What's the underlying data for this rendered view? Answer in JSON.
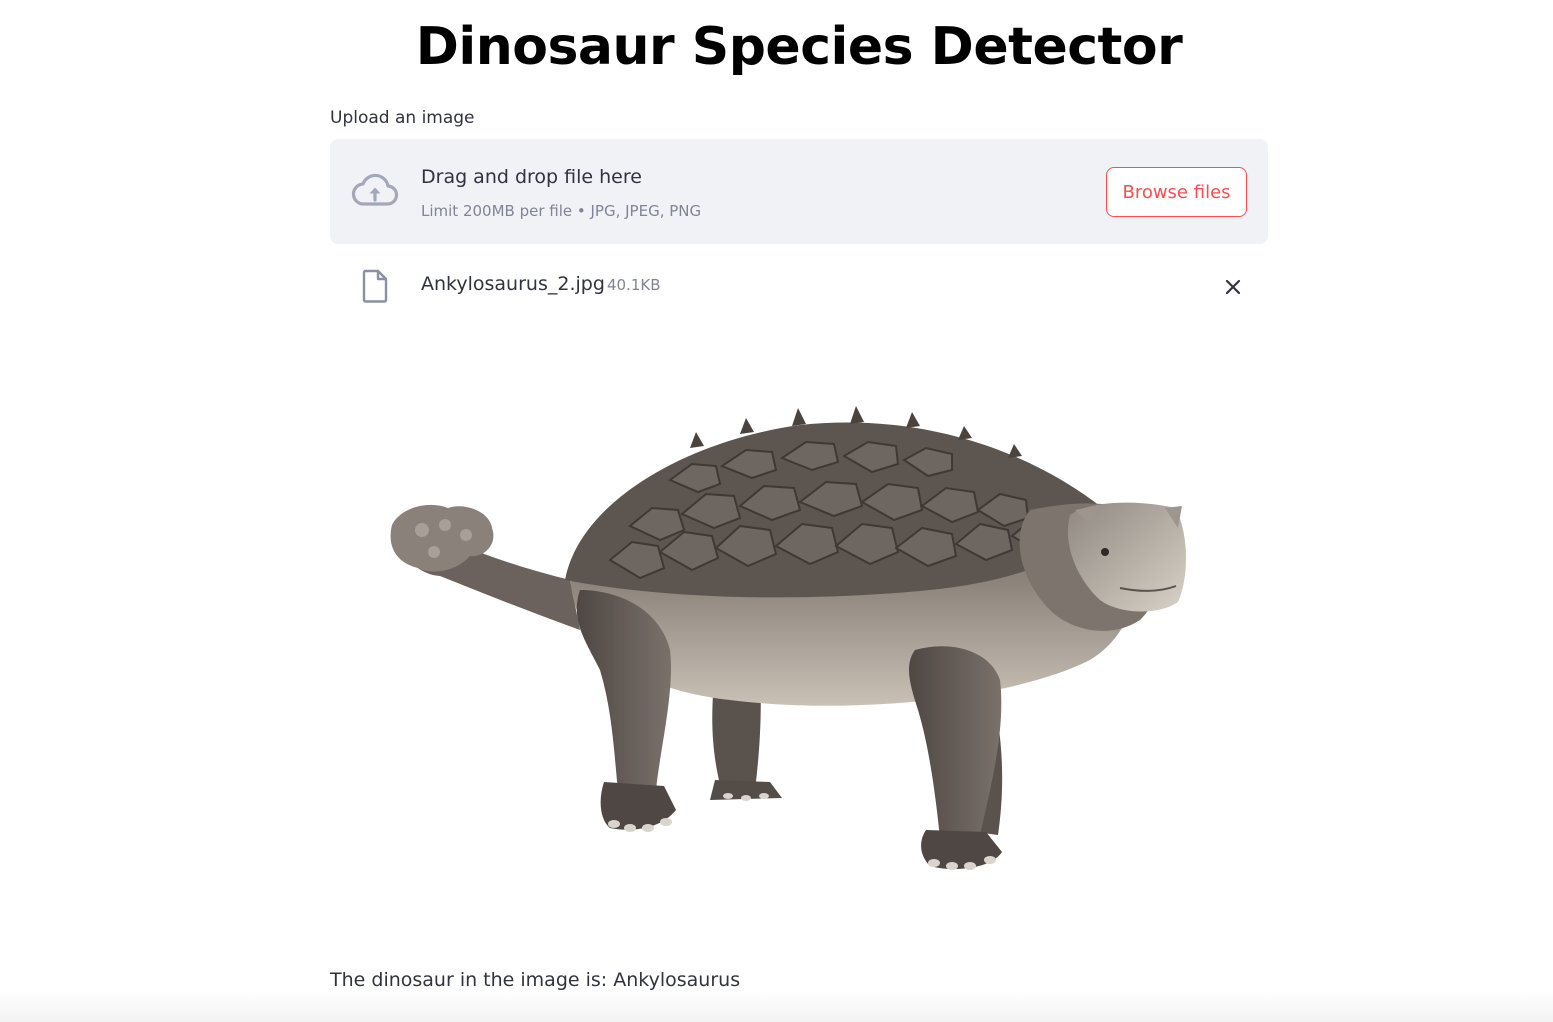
{
  "page": {
    "title": "Dinosaur Species Detector"
  },
  "uploader": {
    "label": "Upload an image",
    "drop_text": "Drag and drop file here",
    "limit_text": "Limit 200MB per file • JPG, JPEG, PNG",
    "browse_label": "Browse files",
    "icon": "cloud-upload-icon"
  },
  "uploaded_file": {
    "name": "Ankylosaurus_2.jpg",
    "size": "40.1KB",
    "icon": "file-icon",
    "remove_icon": "close-icon"
  },
  "image": {
    "subject": "ankylosaurus"
  },
  "result": {
    "text": "The dinosaur in the image is: Ankylosaurus"
  },
  "colors": {
    "accent": "#ff4b4b",
    "dropzone_bg": "#f0f2f6",
    "text": "#31333f",
    "muted": "#808495"
  }
}
